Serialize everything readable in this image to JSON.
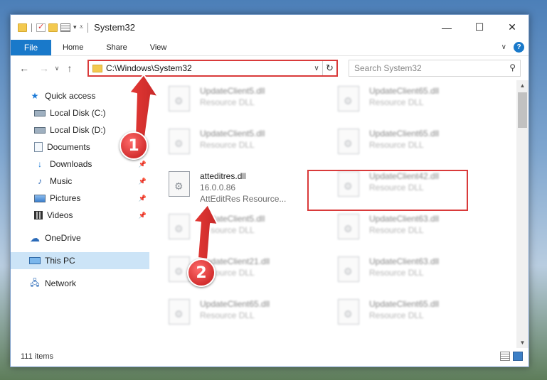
{
  "window": {
    "title": "System32",
    "controls": {
      "minimize": "—",
      "maximize": "☐",
      "close": "✕"
    }
  },
  "ribbon": {
    "tabs": [
      "File",
      "Home",
      "Share",
      "View"
    ]
  },
  "navigation": {
    "back": "←",
    "forward": "→",
    "recent": "∨",
    "up": "↑",
    "address": "C:\\Windows\\System32",
    "search_placeholder": "Search System32"
  },
  "sidebar": {
    "items": [
      {
        "label": "Quick access",
        "icon": "star-icon",
        "level": 0,
        "pinned": false
      },
      {
        "label": "Local Disk (C:)",
        "icon": "drive-icon",
        "level": 1,
        "pinned": true
      },
      {
        "label": "Local Disk (D:)",
        "icon": "drive-icon",
        "level": 1,
        "pinned": true
      },
      {
        "label": "Documents",
        "icon": "documents-icon",
        "level": 1,
        "pinned": true
      },
      {
        "label": "Downloads",
        "icon": "downloads-icon",
        "level": 1,
        "pinned": true
      },
      {
        "label": "Music",
        "icon": "music-icon",
        "level": 1,
        "pinned": true
      },
      {
        "label": "Pictures",
        "icon": "pictures-icon",
        "level": 1,
        "pinned": true
      },
      {
        "label": "Videos",
        "icon": "videos-icon",
        "level": 1,
        "pinned": true
      },
      {
        "label": "OneDrive",
        "icon": "onedrive-icon",
        "level": 0,
        "pinned": false
      },
      {
        "label": "This PC",
        "icon": "computer-icon",
        "level": 0,
        "pinned": false,
        "selected": true
      },
      {
        "label": "Network",
        "icon": "network-icon",
        "level": 0,
        "pinned": false
      }
    ]
  },
  "files": [
    {
      "name": "UpdateClient5.dll",
      "desc": "Resource DLL"
    },
    {
      "name": "UpdateClient65.dll",
      "desc": "Resource DLL"
    },
    {
      "name": "UpdateClient5.dll",
      "desc": "Resource DLL"
    },
    {
      "name": "UpdateClient65.dll",
      "desc": "Resource DLL"
    },
    {
      "name": "atteditres.dll",
      "version": "16.0.0.86",
      "desc": "AttEditRes Resource...",
      "highlighted": true
    },
    {
      "name": "UpdateClient42.dll",
      "desc": "Resource DLL"
    },
    {
      "name": "UpdateClient5.dll",
      "desc": "Resource DLL"
    },
    {
      "name": "UpdateClient63.dll",
      "desc": "Resource DLL"
    },
    {
      "name": "UpdateClient21.dll",
      "desc": "Resource DLL"
    },
    {
      "name": "UpdateClient63.dll",
      "desc": "Resource DLL"
    },
    {
      "name": "UpdateClient65.dll",
      "desc": "Resource DLL"
    },
    {
      "name": "UpdateClient65.dll",
      "desc": "Resource DLL"
    }
  ],
  "status": {
    "item_count": "111 items"
  },
  "callouts": {
    "step1": "1",
    "step2": "2"
  },
  "colors": {
    "accent": "#1979ca",
    "highlight": "#d93a3a",
    "selected": "#cce4f7"
  }
}
